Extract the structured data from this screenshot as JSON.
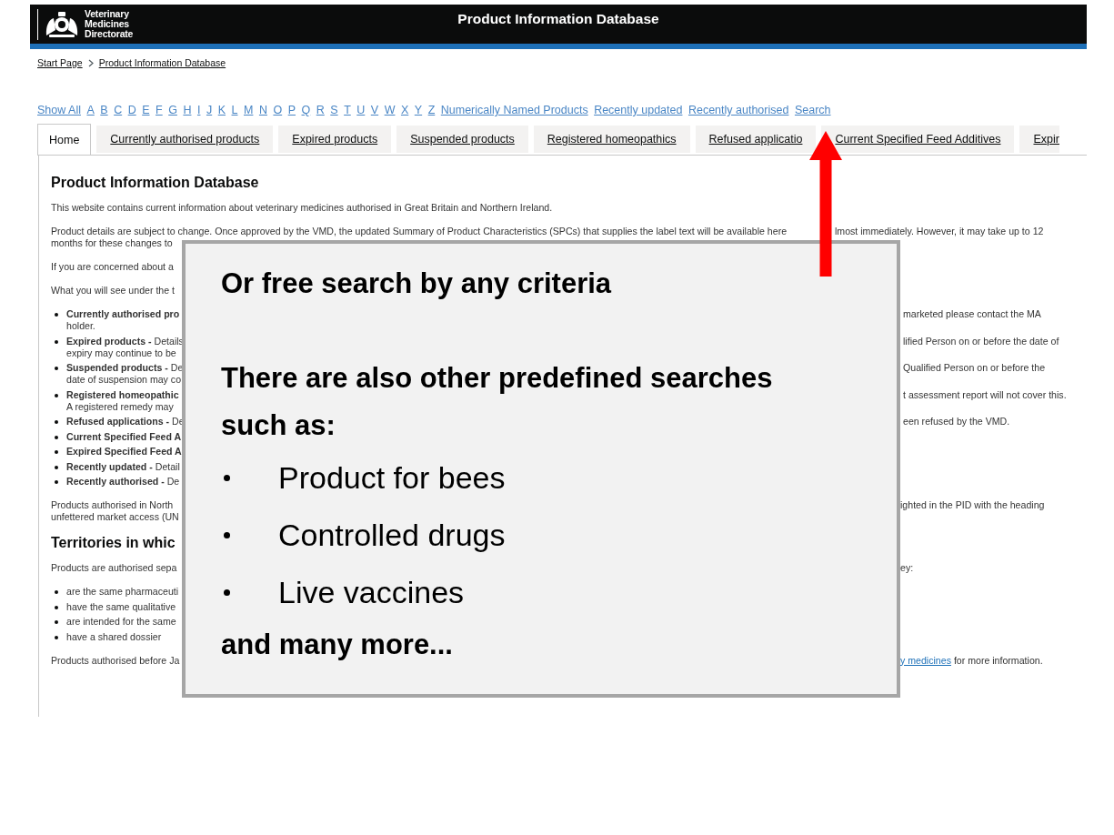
{
  "header": {
    "org_name": "Veterinary Medicines Directorate",
    "title": "Product Information Database"
  },
  "breadcrumb": [
    {
      "label": "Start Page"
    },
    {
      "label": "Product Information Database"
    }
  ],
  "alpha_nav": [
    "Show All",
    "A",
    "B",
    "C",
    "D",
    "E",
    "F",
    "G",
    "H",
    "I",
    "J",
    "K",
    "L",
    "M",
    "N",
    "O",
    "P",
    "Q",
    "R",
    "S",
    "T",
    "U",
    "V",
    "W",
    "X",
    "Y",
    "Z",
    "Numerically Named Products",
    "Recently updated",
    "Recently authorised",
    "Search"
  ],
  "tabs": [
    {
      "label": "Home",
      "selected": true
    },
    {
      "label": "Currently authorised products",
      "selected": false
    },
    {
      "label": "Expired products",
      "selected": false
    },
    {
      "label": "Suspended products",
      "selected": false
    },
    {
      "label": "Registered homeopathics",
      "selected": false
    },
    {
      "label": "Refused applicatio",
      "selected": false
    },
    {
      "label": "Current Specified Feed Additives",
      "selected": false
    },
    {
      "label": "Expir",
      "selected": false
    }
  ],
  "content": [
    {
      "kind": "heading",
      "text": "Product Information Database"
    },
    {
      "kind": "paragraph",
      "lines": [
        {
          "left": "This website contains current information about veterinary medicines authorised in Great Britain and Northern Ireland."
        }
      ]
    },
    {
      "kind": "paragraph",
      "lines": [
        {
          "left": "Product details are subject to change. Once approved by the VMD, the updated Summary of Product Characteristics (SPCs) that supplies the label text will be available here",
          "right": "lmost immediately. However, it may take up to 12",
          "kind": "arrow_gap"
        },
        {
          "left": "months for these changes to"
        }
      ]
    },
    {
      "kind": "paragraph",
      "lines": [
        {
          "left": "If you are concerned about a"
        }
      ]
    },
    {
      "kind": "paragraph",
      "lines": [
        {
          "left": "What you will see under the t"
        }
      ]
    },
    {
      "kind": "bullets",
      "items": [
        {
          "lines": [
            {
              "left": "**Currently authorised pro**",
              "right": "marketed please contact the MA"
            },
            {
              "left": "holder."
            }
          ]
        },
        {
          "lines": [
            {
              "left": "**Expired products -** Details",
              "right": "lified Person on or before the date of"
            },
            {
              "left": "expiry may continue to be"
            }
          ]
        },
        {
          "lines": [
            {
              "left": "**Suspended products -** De",
              "right": "Qualified Person on or before the"
            },
            {
              "left": "date of suspension may co"
            }
          ]
        },
        {
          "lines": [
            {
              "left": "**Registered homeopathic**",
              "right": "t assessment report will not cover this."
            },
            {
              "left": "A registered remedy may"
            }
          ]
        },
        {
          "lines": [
            {
              "left": "**Refused applications -** De",
              "right": "een refused by the VMD."
            }
          ]
        },
        {
          "lines": [
            {
              "left": "**Current Specified Feed A**"
            }
          ]
        },
        {
          "lines": [
            {
              "left": "**Expired Specified Feed A**"
            }
          ]
        },
        {
          "lines": [
            {
              "left": "**Recently updated -** Detail"
            }
          ]
        },
        {
          "lines": [
            {
              "left": "**Recently authorised -** De"
            }
          ]
        }
      ]
    },
    {
      "kind": "paragraph",
      "lines": [
        {
          "left": "Products authorised in North",
          "right": "ighted in the PID with the heading"
        },
        {
          "left": "unfettered market access (UN"
        }
      ]
    },
    {
      "kind": "heading",
      "text": "Territories in whic"
    },
    {
      "kind": "paragraph",
      "lines": [
        {
          "left": "Products are authorised sepa",
          "right": "ey:"
        }
      ]
    },
    {
      "kind": "bullets",
      "items": [
        {
          "lines": [
            {
              "left": "are the same pharmaceuti"
            }
          ]
        },
        {
          "lines": [
            {
              "left": "have the same qualitative"
            }
          ]
        },
        {
          "lines": [
            {
              "left": "are intended for the same"
            }
          ]
        },
        {
          "lines": [
            {
              "left": "have a shared dossier"
            }
          ]
        }
      ]
    },
    {
      "kind": "paragraph",
      "lines": [
        {
          "left": "Products authorised before Ja",
          "right_link": "y medicines",
          "right": " for more information."
        }
      ]
    }
  ],
  "callout": [
    {
      "kind": "heading",
      "text": "Or free search by any criteria"
    },
    {
      "kind": "heading",
      "text": "There are also other predefined searches such as:"
    },
    {
      "kind": "bullet",
      "text": "Product for bees"
    },
    {
      "kind": "bullet",
      "text": "Controlled drugs"
    },
    {
      "kind": "bullet",
      "text": "Live vaccines"
    },
    {
      "kind": "heading",
      "text": "and many more..."
    }
  ]
}
